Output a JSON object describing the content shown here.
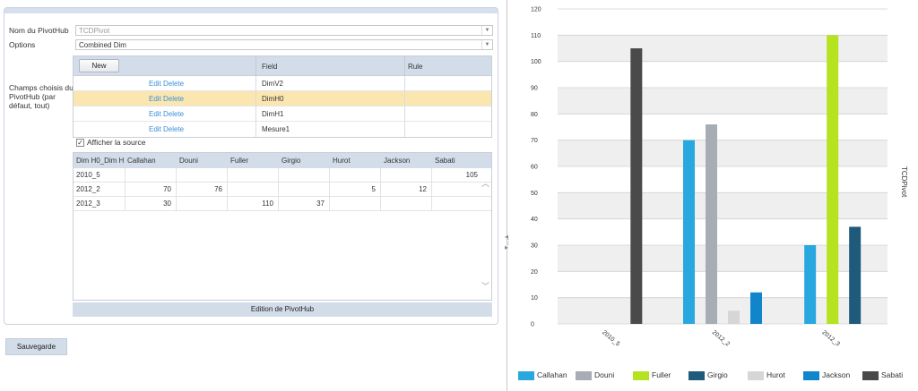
{
  "form": {
    "name_label": "Nom du PivotHub",
    "name_value": "TCDPivot",
    "options_label": "Options",
    "options_value": "Combined Dim",
    "fields_label": "Champs choisis du PivotHub (par défaut, tout)"
  },
  "grid": {
    "new_label": "New",
    "col_field": "Field",
    "col_rule": "Rule",
    "rows": [
      {
        "actions": "Edit Delete",
        "field": "DimV2"
      },
      {
        "actions": "Edit Delete",
        "field": "DimH0"
      },
      {
        "actions": "Edit Delete",
        "field": "DimH1"
      },
      {
        "actions": "Edit Delete",
        "field": "Mesure1"
      }
    ],
    "selected_index": 1
  },
  "source": {
    "checkbox_label": "Afficher la source",
    "checked": true,
    "headers": [
      "Dim H0_Dim H",
      "Callahan",
      "Douni",
      "Fuller",
      "Girgio",
      "Hurot",
      "Jackson",
      "Sabati"
    ],
    "rows": [
      [
        "2010_5",
        "",
        "",
        "",
        "",
        "",
        "",
        "105"
      ],
      [
        "2012_2",
        "70",
        "76",
        "",
        "",
        "5",
        "12",
        ""
      ],
      [
        "2012_3",
        "30",
        "",
        "110",
        "37",
        "",
        "",
        ""
      ]
    ]
  },
  "edit_button": "Edition de PivotHub",
  "save_button": "Sauvegarde",
  "chart_data": {
    "type": "bar",
    "categories": [
      "2010_5",
      "2012_2",
      "2012_3"
    ],
    "ylim": [
      0,
      120
    ],
    "yticks": [
      0,
      10,
      20,
      30,
      40,
      50,
      60,
      70,
      80,
      90,
      100,
      110,
      120
    ],
    "ylabel": "TCDPivot",
    "legend_position": "bottom",
    "series": [
      {
        "name": "Callahan",
        "color": "#29a8e0",
        "values": [
          null,
          70,
          30
        ]
      },
      {
        "name": "Douni",
        "color": "#a7adb4",
        "values": [
          null,
          76,
          null
        ]
      },
      {
        "name": "Fuller",
        "color": "#b5e31f",
        "values": [
          null,
          null,
          110
        ]
      },
      {
        "name": "Girgio",
        "color": "#1f5a7a",
        "values": [
          null,
          null,
          37
        ]
      },
      {
        "name": "Hurot",
        "color": "#d6d6d6",
        "values": [
          null,
          5,
          null
        ]
      },
      {
        "name": "Jackson",
        "color": "#1085cc",
        "values": [
          null,
          12,
          null
        ]
      },
      {
        "name": "Sabati",
        "color": "#4a4a4a",
        "values": [
          105,
          null,
          null
        ]
      }
    ]
  }
}
